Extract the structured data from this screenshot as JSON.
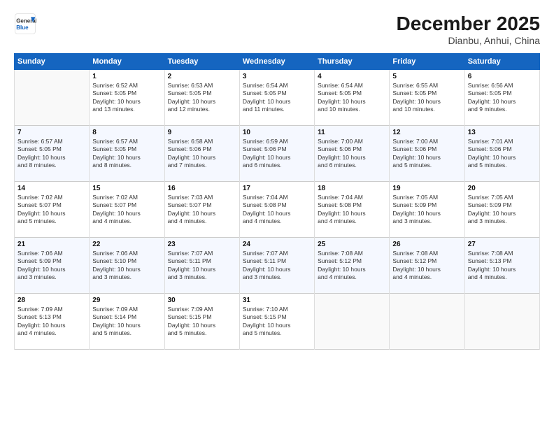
{
  "header": {
    "logo_general": "General",
    "logo_blue": "Blue",
    "month_title": "December 2025",
    "subtitle": "Dianbu, Anhui, China"
  },
  "columns": [
    "Sunday",
    "Monday",
    "Tuesday",
    "Wednesday",
    "Thursday",
    "Friday",
    "Saturday"
  ],
  "weeks": [
    {
      "days": [
        {
          "num": "",
          "info": "",
          "empty": true
        },
        {
          "num": "1",
          "info": "Sunrise: 6:52 AM\nSunset: 5:05 PM\nDaylight: 10 hours\nand 13 minutes."
        },
        {
          "num": "2",
          "info": "Sunrise: 6:53 AM\nSunset: 5:05 PM\nDaylight: 10 hours\nand 12 minutes."
        },
        {
          "num": "3",
          "info": "Sunrise: 6:54 AM\nSunset: 5:05 PM\nDaylight: 10 hours\nand 11 minutes."
        },
        {
          "num": "4",
          "info": "Sunrise: 6:54 AM\nSunset: 5:05 PM\nDaylight: 10 hours\nand 10 minutes."
        },
        {
          "num": "5",
          "info": "Sunrise: 6:55 AM\nSunset: 5:05 PM\nDaylight: 10 hours\nand 10 minutes."
        },
        {
          "num": "6",
          "info": "Sunrise: 6:56 AM\nSunset: 5:05 PM\nDaylight: 10 hours\nand 9 minutes."
        }
      ]
    },
    {
      "days": [
        {
          "num": "7",
          "info": "Sunrise: 6:57 AM\nSunset: 5:05 PM\nDaylight: 10 hours\nand 8 minutes."
        },
        {
          "num": "8",
          "info": "Sunrise: 6:57 AM\nSunset: 5:05 PM\nDaylight: 10 hours\nand 8 minutes."
        },
        {
          "num": "9",
          "info": "Sunrise: 6:58 AM\nSunset: 5:06 PM\nDaylight: 10 hours\nand 7 minutes."
        },
        {
          "num": "10",
          "info": "Sunrise: 6:59 AM\nSunset: 5:06 PM\nDaylight: 10 hours\nand 6 minutes."
        },
        {
          "num": "11",
          "info": "Sunrise: 7:00 AM\nSunset: 5:06 PM\nDaylight: 10 hours\nand 6 minutes."
        },
        {
          "num": "12",
          "info": "Sunrise: 7:00 AM\nSunset: 5:06 PM\nDaylight: 10 hours\nand 5 minutes."
        },
        {
          "num": "13",
          "info": "Sunrise: 7:01 AM\nSunset: 5:06 PM\nDaylight: 10 hours\nand 5 minutes."
        }
      ]
    },
    {
      "days": [
        {
          "num": "14",
          "info": "Sunrise: 7:02 AM\nSunset: 5:07 PM\nDaylight: 10 hours\nand 5 minutes."
        },
        {
          "num": "15",
          "info": "Sunrise: 7:02 AM\nSunset: 5:07 PM\nDaylight: 10 hours\nand 4 minutes."
        },
        {
          "num": "16",
          "info": "Sunrise: 7:03 AM\nSunset: 5:07 PM\nDaylight: 10 hours\nand 4 minutes."
        },
        {
          "num": "17",
          "info": "Sunrise: 7:04 AM\nSunset: 5:08 PM\nDaylight: 10 hours\nand 4 minutes."
        },
        {
          "num": "18",
          "info": "Sunrise: 7:04 AM\nSunset: 5:08 PM\nDaylight: 10 hours\nand 4 minutes."
        },
        {
          "num": "19",
          "info": "Sunrise: 7:05 AM\nSunset: 5:09 PM\nDaylight: 10 hours\nand 3 minutes."
        },
        {
          "num": "20",
          "info": "Sunrise: 7:05 AM\nSunset: 5:09 PM\nDaylight: 10 hours\nand 3 minutes."
        }
      ]
    },
    {
      "days": [
        {
          "num": "21",
          "info": "Sunrise: 7:06 AM\nSunset: 5:09 PM\nDaylight: 10 hours\nand 3 minutes."
        },
        {
          "num": "22",
          "info": "Sunrise: 7:06 AM\nSunset: 5:10 PM\nDaylight: 10 hours\nand 3 minutes."
        },
        {
          "num": "23",
          "info": "Sunrise: 7:07 AM\nSunset: 5:11 PM\nDaylight: 10 hours\nand 3 minutes."
        },
        {
          "num": "24",
          "info": "Sunrise: 7:07 AM\nSunset: 5:11 PM\nDaylight: 10 hours\nand 3 minutes."
        },
        {
          "num": "25",
          "info": "Sunrise: 7:08 AM\nSunset: 5:12 PM\nDaylight: 10 hours\nand 4 minutes."
        },
        {
          "num": "26",
          "info": "Sunrise: 7:08 AM\nSunset: 5:12 PM\nDaylight: 10 hours\nand 4 minutes."
        },
        {
          "num": "27",
          "info": "Sunrise: 7:08 AM\nSunset: 5:13 PM\nDaylight: 10 hours\nand 4 minutes."
        }
      ]
    },
    {
      "days": [
        {
          "num": "28",
          "info": "Sunrise: 7:09 AM\nSunset: 5:13 PM\nDaylight: 10 hours\nand 4 minutes."
        },
        {
          "num": "29",
          "info": "Sunrise: 7:09 AM\nSunset: 5:14 PM\nDaylight: 10 hours\nand 5 minutes."
        },
        {
          "num": "30",
          "info": "Sunrise: 7:09 AM\nSunset: 5:15 PM\nDaylight: 10 hours\nand 5 minutes."
        },
        {
          "num": "31",
          "info": "Sunrise: 7:10 AM\nSunset: 5:15 PM\nDaylight: 10 hours\nand 5 minutes."
        },
        {
          "num": "",
          "info": "",
          "empty": true
        },
        {
          "num": "",
          "info": "",
          "empty": true
        },
        {
          "num": "",
          "info": "",
          "empty": true
        }
      ]
    }
  ]
}
